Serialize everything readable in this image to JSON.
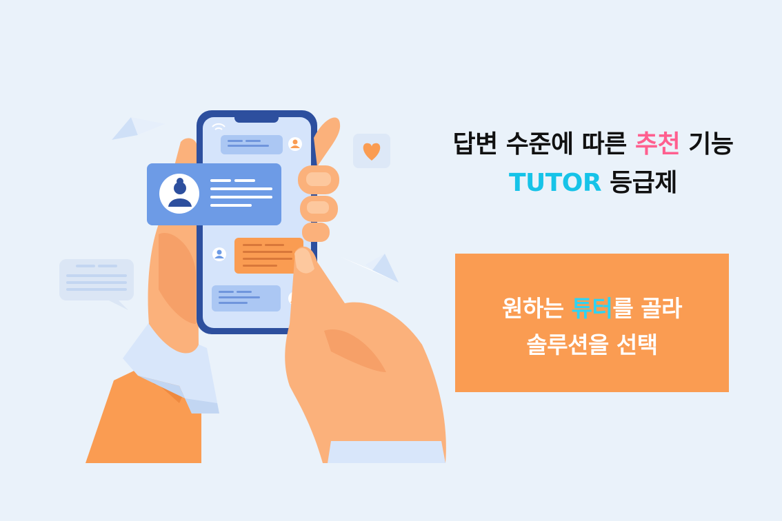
{
  "headline": {
    "line1_prefix": "답변 수준에 따른 ",
    "line1_highlight": "추천",
    "line1_suffix": " 기능",
    "line2_highlight": "TUTOR",
    "line2_suffix": " 등급제"
  },
  "feature_box": {
    "line1_prefix": "원하는 ",
    "line1_highlight": "튜터",
    "line1_suffix": "를 골라",
    "line2": "솔루션을 선택"
  },
  "colors": {
    "background": "#eaf2fa",
    "highlight_pink": "#ff5f8f",
    "highlight_cyan": "#16c3e8",
    "box_orange": "#fa9c52",
    "box_highlight": "#2fd3f2",
    "phone_frame": "#2d4f9e",
    "skin": "#fbb17b"
  },
  "icons": [
    "paper-plane-icon",
    "heart-icon",
    "wifi-icon",
    "avatar-icon",
    "speech-bubble-icon"
  ]
}
